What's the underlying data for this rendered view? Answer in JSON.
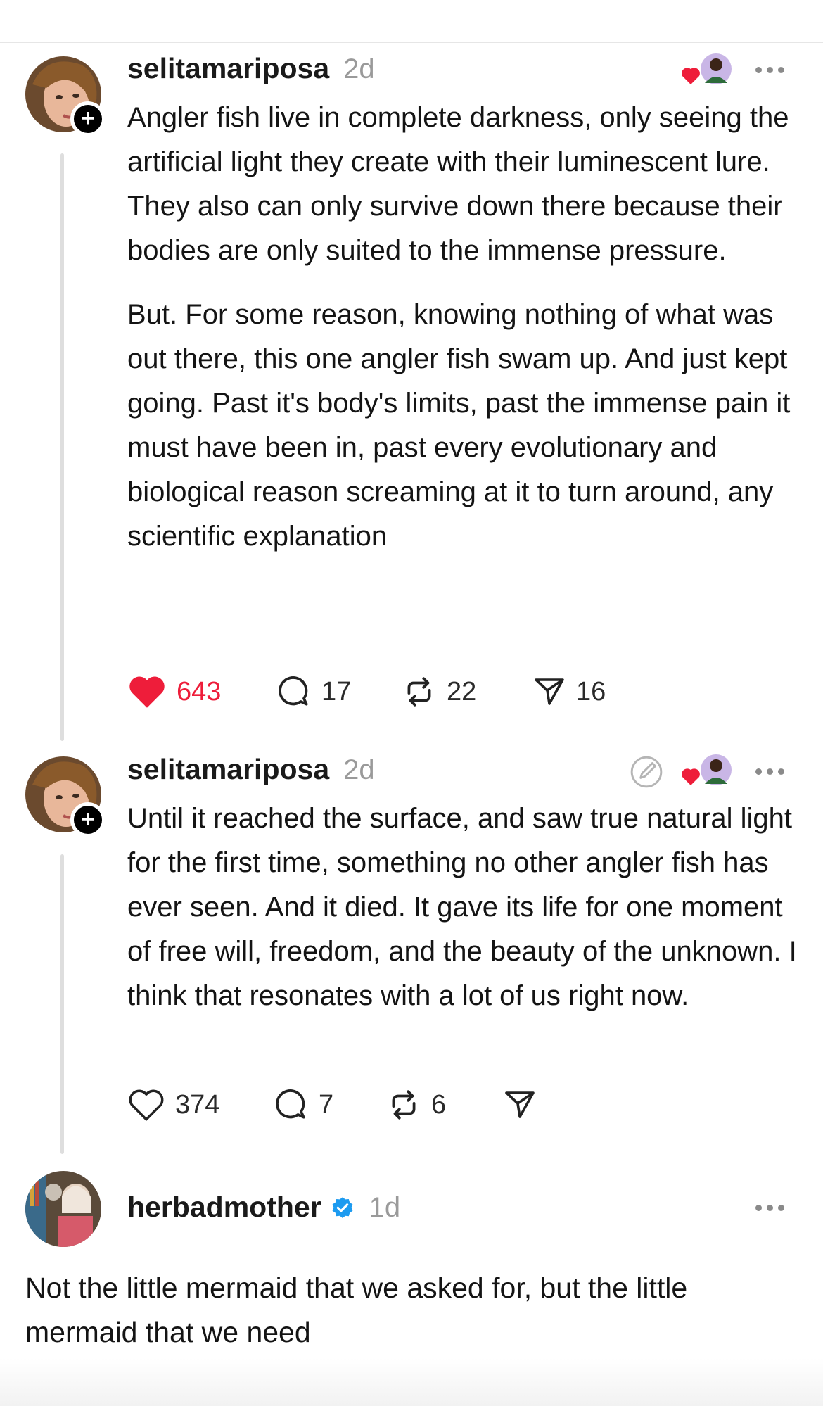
{
  "posts": [
    {
      "username": "selitamariposa",
      "time": "2d",
      "avatar_icon": "profile-photo",
      "paragraphs": [
        "Angler fish live in complete darkness, only seeing the artificial light they create with their luminescent lure. They also can only survive down there because their bodies are only suited to the immense pressure.",
        "But. For some reason, knowing nothing of what was out there, this one angler fish swam up. And just kept going. Past it's body's limits, past the immense pain it must have been in, past every evolutionary and biological reason screaming at it to turn around, any scientific explanation"
      ],
      "likes": "643",
      "comments": "17",
      "reposts": "22",
      "shares": "16",
      "liked": true
    },
    {
      "username": "selitamariposa",
      "time": "2d",
      "avatar_icon": "profile-photo",
      "paragraphs": [
        "Until it reached the surface, and saw true natural light for the first time, something no other angler fish has ever seen. And it died. It gave its life for one moment of free will, freedom, and the beauty of the unknown. I think that resonates with a lot of us right now."
      ],
      "likes": "374",
      "comments": "7",
      "reposts": "6",
      "liked": false
    }
  ],
  "reply": {
    "username": "herbadmother",
    "time": "1d",
    "verified": true,
    "text": "Not the little mermaid that we asked for, but the little mermaid that we need"
  },
  "colors": {
    "like_red": "#ee1d3a",
    "verified_blue": "#1d9bf0",
    "thread_line": "#dedede"
  }
}
